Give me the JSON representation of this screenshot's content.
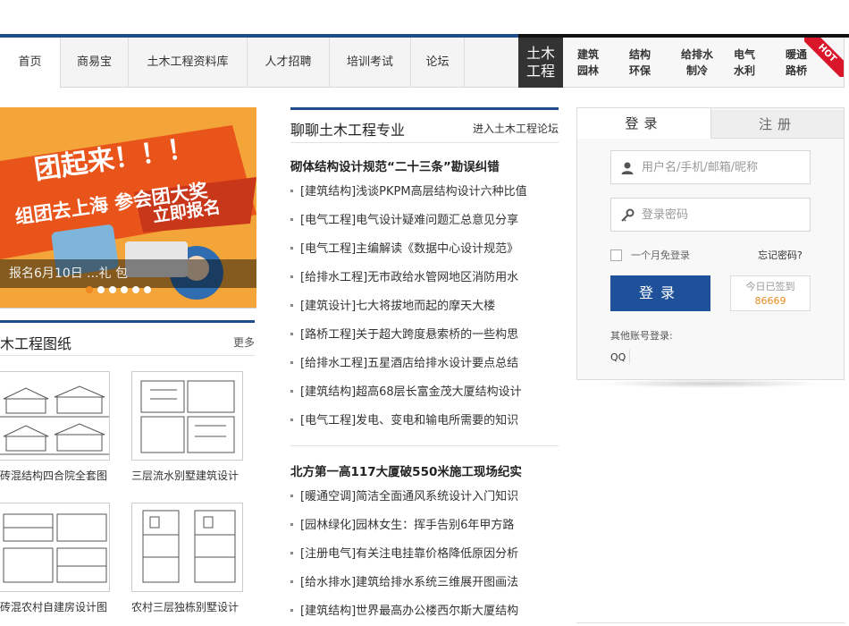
{
  "nav": {
    "items": [
      {
        "label": "首页",
        "active": true
      },
      {
        "label": "商易宝"
      },
      {
        "label": "土木工程资料库"
      },
      {
        "label": "人才招聘"
      },
      {
        "label": "培训考试"
      },
      {
        "label": "论坛"
      }
    ]
  },
  "categories": {
    "title_line1": "土木",
    "title_line2": "工程",
    "items": [
      {
        "line1": "建筑",
        "line2": "园林"
      },
      {
        "line1": "结构",
        "line2": "环保"
      },
      {
        "line1": "给排水",
        "line2": "制冷"
      },
      {
        "line1": "电气",
        "line2": "水利"
      },
      {
        "line1": "暖通",
        "line2": "路桥"
      }
    ],
    "hot_badge": "HOT"
  },
  "banner": {
    "headline1": "团起来！！！",
    "headline2": "组团去上海  参会团大奖",
    "cta": "立即报名",
    "caption": "报名6月10日 ...礼 包",
    "dots": 6,
    "active_dot": 0,
    "bg_color": "#f3a53a",
    "accent_color": "#e9541b"
  },
  "drawings": {
    "title": "木工程图纸",
    "more": "更多",
    "items": [
      {
        "caption": "砖混结构四合院全套图"
      },
      {
        "caption": "三层流水别墅建筑设计"
      },
      {
        "caption": "砖混农村自建房设计图"
      },
      {
        "caption": "农村三层独栋别墅设计"
      }
    ]
  },
  "forum": {
    "title": "聊聊土木工程专业",
    "more": "进入土木工程论坛",
    "headline1": "砌体结构设计规范“二十三条”勘误纠错",
    "list1": [
      "[建筑结构]浅谈PKPM高层结构设计六种比值",
      "[电气工程]电气设计疑难问题汇总意见分享",
      "[电气工程]主编解读《数据中心设计规范》",
      "[给排水工程]无市政给水管网地区消防用水",
      "[建筑设计]七大将拔地而起的摩天大楼",
      "[路桥工程]关于超大跨度悬索桥的一些构思",
      "[给排水工程]五星酒店给排水设计要点总结",
      "[建筑结构]超高68层长富金茂大厦结构设计",
      "[电气工程]发电、变电和输电所需要的知识"
    ],
    "headline2": "北方第一高117大厦破550米施工现场纪实",
    "list2": [
      "[暖通空调]简洁全面通风系统设计入门知识",
      "[园林绿化]园林女生：挥手告别6年甲方路",
      "[注册电气]有关注电挂靠价格降低原因分析",
      "[给水排水]建筑给排水系统三维展开图画法",
      "[建筑结构]世界最高办公楼西尔斯大厦结构"
    ]
  },
  "login": {
    "tab_login": "登录",
    "tab_register": "注册",
    "username_placeholder": "用户名/手机/邮箱/昵称",
    "password_placeholder": "登录密码",
    "remember_label": "一个月免登录",
    "forgot_label": "忘记密码?",
    "login_button": "登录",
    "signin_label": "今日已签到",
    "signin_count": "86669",
    "other_login_label": "其他账号登录:",
    "qq_label": "QQ"
  }
}
